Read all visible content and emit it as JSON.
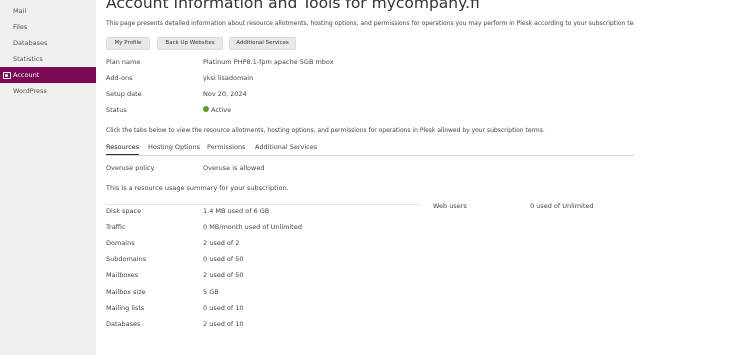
{
  "sidebar": {
    "items": [
      {
        "label": "Mail"
      },
      {
        "label": "Files"
      },
      {
        "label": "Databases"
      },
      {
        "label": "Statistics"
      },
      {
        "label": "Account",
        "active": true
      },
      {
        "label": "WordPress"
      }
    ],
    "collapse_glyph": "‹"
  },
  "page": {
    "title": "Account Information and Tools for mycompany.fi",
    "description": "This page presents detailed information about resource allotments, hosting options, and permissions for operations you may perform in Plesk according to your subscription terms."
  },
  "toolbar": {
    "buttons": [
      "My Profile",
      "Back Up Websites",
      "Additional Services"
    ]
  },
  "info": {
    "rows": [
      {
        "label": "Plan name",
        "value": "Platinum PHP8.1-fpm apache 5GB mbox"
      },
      {
        "label": "Add-ons",
        "value": "yksi lisadomain"
      },
      {
        "label": "Setup date",
        "value": "Nov 20, 2024"
      },
      {
        "label": "Status",
        "value": "Active"
      }
    ],
    "status_color": "#5aa02c"
  },
  "tabs_note": "Click the tabs below to view the resource allotments, hosting options, and permissions for operations in Plesk allowed by your subscription terms.",
  "tabs": [
    "Resources",
    "Hosting Options",
    "Permissions",
    "Additional Services"
  ],
  "resources": {
    "overuse_label": "Overuse policy",
    "overuse_value": "Overuse is allowed",
    "summary": "This is a resource usage summary for your subscription.",
    "left": [
      {
        "label": "Disk space",
        "value": "1.4 MB used of 6 GB"
      },
      {
        "label": "Traffic",
        "value": "0 MB/month used of Unlimited"
      },
      {
        "label": "Domains",
        "value": "2 used of 2"
      },
      {
        "label": "Subdomains",
        "value": "0 used of 50"
      },
      {
        "label": "Mailboxes",
        "value": "2 used of 50"
      },
      {
        "label": "Mailbox size",
        "value": "5 GB"
      },
      {
        "label": "Mailing lists",
        "value": "0 used of 10"
      },
      {
        "label": "Databases",
        "value": "2 used of 10"
      }
    ],
    "right": [
      {
        "label": "Web users",
        "value": "0 used of Unlimited"
      }
    ]
  },
  "colors": {
    "accent": "#7a0a56",
    "sidebar_bg": "#f0f0f0"
  }
}
